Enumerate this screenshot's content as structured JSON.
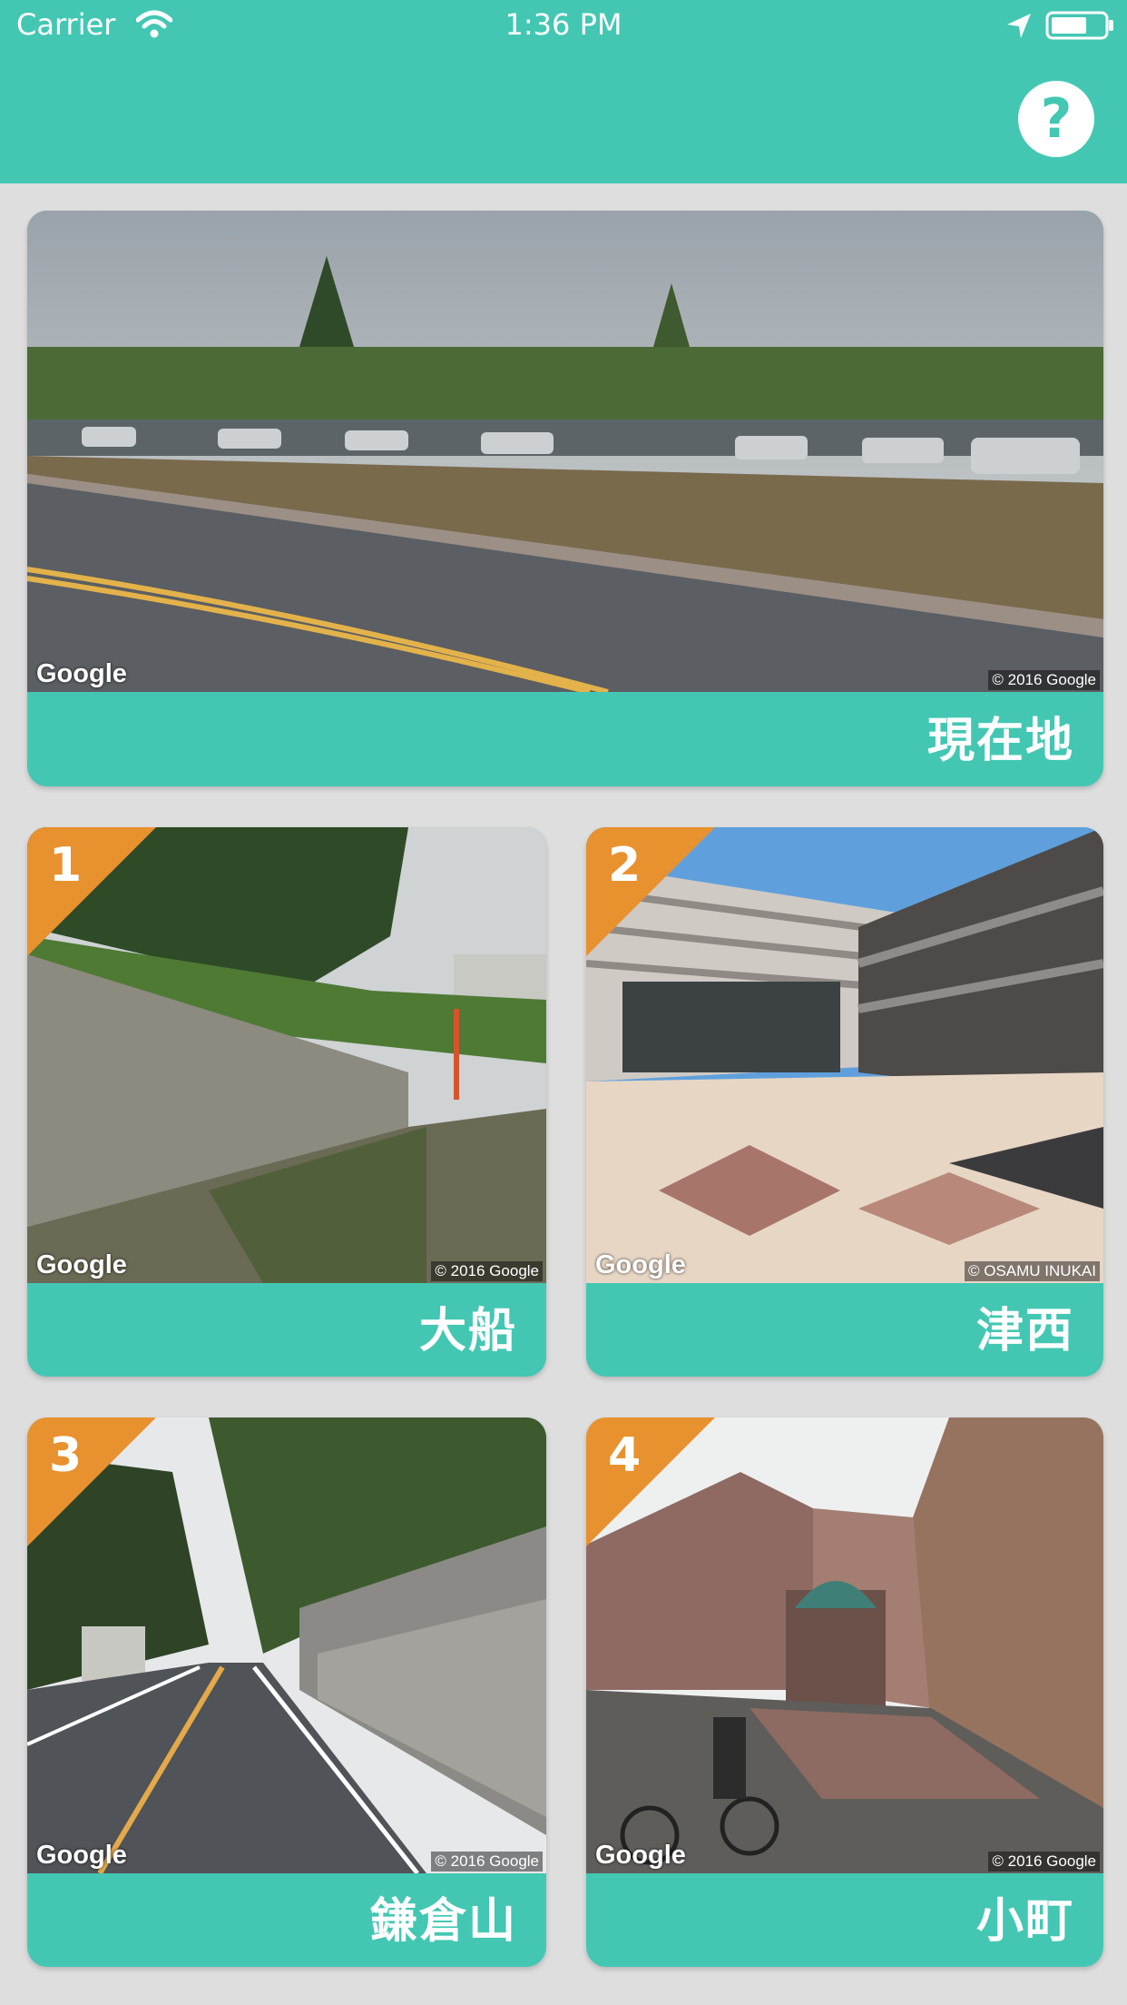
{
  "status_bar": {
    "carrier": "Carrier",
    "time": "1:36 PM"
  },
  "nav": {
    "help_label": "?"
  },
  "colors": {
    "accent": "#43c7b3",
    "badge": "#e8912f",
    "background": "#dedede"
  },
  "current_location": {
    "label": "現在地",
    "attribution": "Google",
    "copyright": "© 2016 Google"
  },
  "spots": [
    {
      "number": "1",
      "label": "大船",
      "attribution": "Google",
      "copyright": "© 2016 Google"
    },
    {
      "number": "2",
      "label": "津西",
      "attribution": "Google",
      "copyright": "© OSAMU INUKAI"
    },
    {
      "number": "3",
      "label": "鎌倉山",
      "attribution": "Google",
      "copyright": "© 2016 Google"
    },
    {
      "number": "4",
      "label": "小町",
      "attribution": "Google",
      "copyright": "© 2016 Google"
    }
  ]
}
